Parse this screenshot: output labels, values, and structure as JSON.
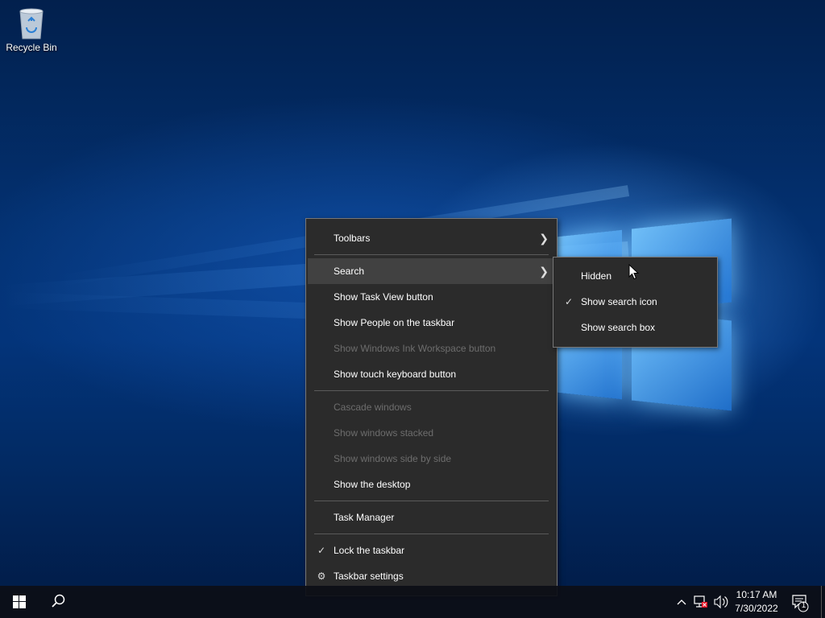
{
  "desktop": {
    "icons": [
      {
        "label": "Recycle Bin",
        "icon": "recycle-bin-icon"
      }
    ]
  },
  "context_menu": {
    "items": [
      {
        "label": "Toolbars",
        "enabled": true,
        "submenu": true
      },
      {
        "label": "Search",
        "enabled": true,
        "submenu": true,
        "highlighted": true
      },
      {
        "label": "Show Task View button",
        "enabled": true
      },
      {
        "label": "Show People on the taskbar",
        "enabled": true
      },
      {
        "label": "Show Windows Ink Workspace button",
        "enabled": false
      },
      {
        "label": "Show touch keyboard button",
        "enabled": true
      },
      {
        "label": "Cascade windows",
        "enabled": false
      },
      {
        "label": "Show windows stacked",
        "enabled": false
      },
      {
        "label": "Show windows side by side",
        "enabled": false
      },
      {
        "label": "Show the desktop",
        "enabled": true
      },
      {
        "label": "Task Manager",
        "enabled": true
      },
      {
        "label": "Lock the taskbar",
        "enabled": true,
        "checked": true
      },
      {
        "label": "Taskbar settings",
        "enabled": true,
        "icon": "gear-icon"
      }
    ]
  },
  "search_submenu": {
    "items": [
      {
        "label": "Hidden",
        "checked": false
      },
      {
        "label": "Show search icon",
        "checked": true
      },
      {
        "label": "Show search box",
        "checked": false
      }
    ]
  },
  "taskbar": {
    "start_icon": "windows-start-icon",
    "search_icon": "search-icon",
    "tray_icons": [
      "chevron-up-icon",
      "network-icon",
      "volume-icon"
    ],
    "clock": {
      "time": "10:17 AM",
      "date": "7/30/2022"
    },
    "notifications": {
      "icon": "action-center-icon",
      "count": "1"
    }
  },
  "colors": {
    "menu_bg": "#2b2b2b",
    "menu_highlight": "#414141",
    "disabled_text": "#6d6d6d",
    "taskbar_bg": "#0c0e16"
  }
}
